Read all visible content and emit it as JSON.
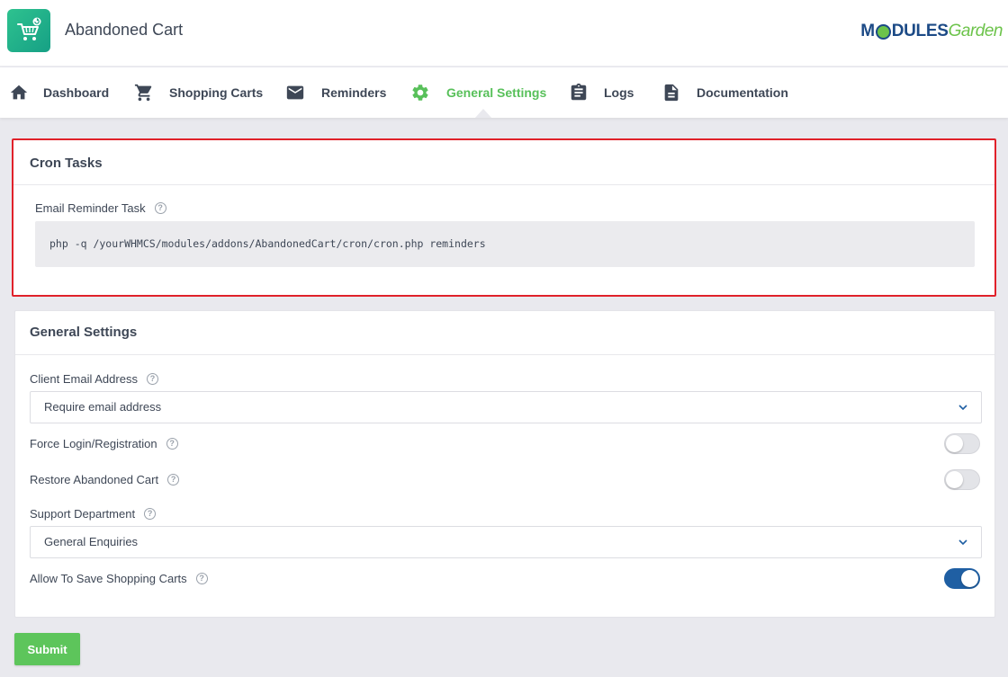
{
  "app": {
    "title": "Abandoned Cart",
    "logo_icon": "shopping-cart-refresh-icon",
    "brand_part1": "M",
    "brand_part2": "DULES",
    "brand_part3": "Garden"
  },
  "nav": {
    "items": [
      {
        "label": "Dashboard",
        "icon": "home-icon"
      },
      {
        "label": "Shopping Carts",
        "icon": "cart-icon"
      },
      {
        "label": "Reminders",
        "icon": "envelope-icon"
      },
      {
        "label": "General Settings",
        "icon": "gear-icon",
        "active": true
      },
      {
        "label": "Logs",
        "icon": "clipboard-icon"
      },
      {
        "label": "Documentation",
        "icon": "document-icon"
      }
    ]
  },
  "cron": {
    "title": "Cron Tasks",
    "task_label": "Email Reminder Task",
    "command": "php -q /yourWHMCS/modules/addons/AbandonedCart/cron/cron.php reminders"
  },
  "general": {
    "title": "General Settings",
    "client_email_label": "Client Email Address",
    "client_email_value": "Require email address",
    "force_login_label": "Force Login/Registration",
    "force_login_on": false,
    "restore_label": "Restore Abandoned Cart",
    "restore_on": false,
    "support_dept_label": "Support Department",
    "support_dept_value": "General Enquiries",
    "allow_save_label": "Allow To Save Shopping Carts",
    "allow_save_on": true
  },
  "actions": {
    "submit_label": "Submit"
  },
  "colors": {
    "accent_green": "#58c05a",
    "toggle_on": "#1f5fa3",
    "highlight_border": "#e0212a"
  }
}
